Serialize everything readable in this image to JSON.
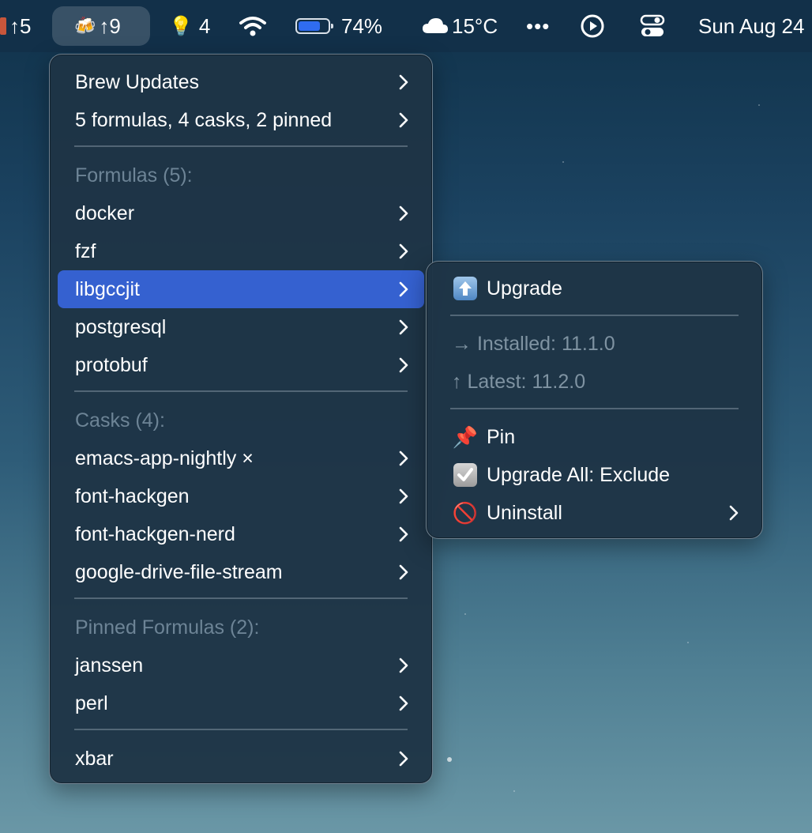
{
  "menubar": {
    "left_item": "↑5",
    "brew_item": "↑9",
    "bulb_item": "4",
    "battery_percent": "74%",
    "battery_level": 0.74,
    "weather": "15°C",
    "more": "•••",
    "clock": "Sun Aug 24"
  },
  "main_menu": {
    "title": "Brew Updates",
    "summary": "5 formulas, 4 casks, 2 pinned",
    "formulas_header": "Formulas (5):",
    "formulas": [
      "docker",
      "fzf",
      "libgccjit",
      "postgresql",
      "protobuf"
    ],
    "casks_header": "Casks (4):",
    "casks": [
      "emacs-app-nightly ×",
      "font-hackgen",
      "font-hackgen-nerd",
      "google-drive-file-stream"
    ],
    "pinned_header": "Pinned Formulas (2):",
    "pinned": [
      "janssen",
      "perl"
    ],
    "footer": "xbar"
  },
  "submenu": {
    "upgrade": "Upgrade",
    "installed": "→ Installed: 11.1.0",
    "latest": "↑ Latest: 11.2.0",
    "pin": "Pin",
    "upgrade_all_exclude": "Upgrade All: Exclude",
    "uninstall": "Uninstall"
  },
  "colors": {
    "highlight": "#3561d0",
    "menubar": "#123049",
    "battery_fill": "#2f6cf0"
  }
}
